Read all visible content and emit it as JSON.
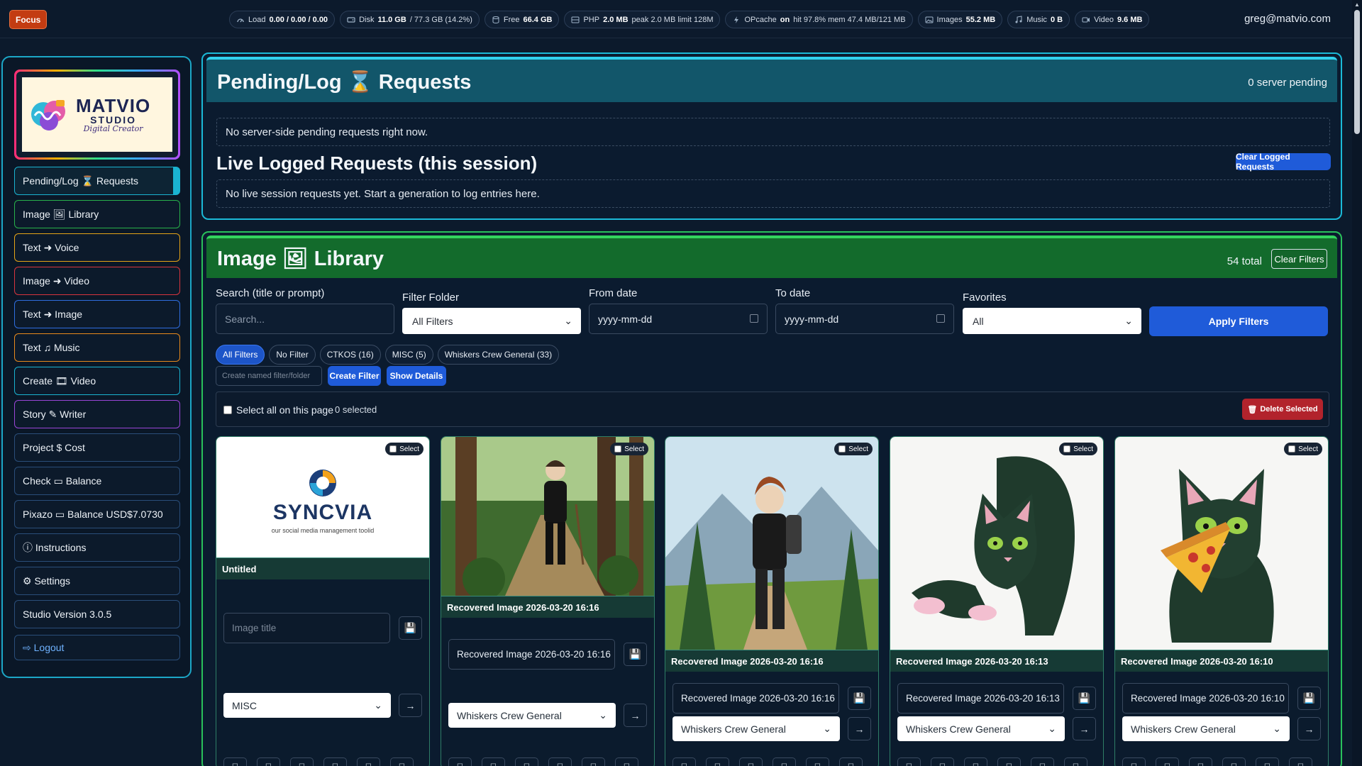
{
  "topbar": {
    "focus_label": "Focus",
    "stats": [
      {
        "icon": "gauge-icon",
        "label": "Load",
        "value": "0.00 / 0.00 / 0.00",
        "suffix": ""
      },
      {
        "icon": "disk-icon",
        "label": "Disk",
        "value": "11.0 GB",
        "suffix": "/ 77.3 GB (14.2%)"
      },
      {
        "icon": "storage-icon",
        "label": "Free",
        "value": "66.4 GB",
        "suffix": ""
      },
      {
        "icon": "server-icon",
        "label": "PHP",
        "value": "2.0 MB",
        "suffix": "peak 2.0 MB limit 128M"
      },
      {
        "icon": "bolt-icon",
        "label": "OPcache",
        "value": "on",
        "suffix": "hit 97.8% mem 47.4 MB/121 MB"
      },
      {
        "icon": "image-icon",
        "label": "Images",
        "value": "55.2 MB",
        "suffix": ""
      },
      {
        "icon": "music-icon",
        "label": "Music",
        "value": "0 B",
        "suffix": ""
      },
      {
        "icon": "video-icon",
        "label": "Video",
        "value": "9.6 MB",
        "suffix": ""
      }
    ],
    "user_email": "greg@matvio.com"
  },
  "logo": {
    "line1": "MATVIO",
    "line2": "STUDIO",
    "line3": "Digital Creator"
  },
  "sidebar": {
    "items": [
      {
        "label": "Pending/Log ⌛ Requests",
        "color": "#1ab3d1",
        "active": true
      },
      {
        "label": "Image 🖼 Library",
        "color": "#28b24b"
      },
      {
        "label": "Text ➜ Voice",
        "color": "#e6a417"
      },
      {
        "label": "Image ➜ Video",
        "color": "#d8353e"
      },
      {
        "label": "Text ➜ Image",
        "color": "#2f6ee0"
      },
      {
        "label": "Text ♫ Music",
        "color": "#e98a1c"
      },
      {
        "label": "Create 🎞 Video",
        "color": "#1ab3d1"
      },
      {
        "label": "Story ✎ Writer",
        "color": "#9a46d8"
      },
      {
        "label": "Project $ Cost",
        "color": "#2a4e7a"
      },
      {
        "label": "Check ▭ Balance",
        "color": "#2a4e7a"
      },
      {
        "label": "Pixazo ▭ Balance USD$7.0730",
        "color": "#2a4e7a"
      },
      {
        "label": "ⓘ Instructions",
        "color": "#2a4e7a"
      },
      {
        "label": "⚙ Settings",
        "color": "#2a4e7a"
      },
      {
        "label": "Studio Version 3.0.5",
        "color": "#2a4e7a"
      },
      {
        "label": "⇨ Logout",
        "color": "#2a4e7a",
        "link": true
      }
    ]
  },
  "pending": {
    "title": "Pending/Log ⌛ Requests",
    "count": "0 server pending",
    "empty_msg": "No server-side pending requests right now.",
    "live_title": "Live Logged Requests (this session)",
    "clear_btn": "Clear Logged Requests",
    "live_empty_msg": "No live session requests yet. Start a generation to log entries here."
  },
  "library": {
    "title": "Image 🖼 Library",
    "total": "54 total",
    "clear_filters": "Clear Filters",
    "filters": {
      "search_label": "Search (title or prompt)",
      "search_placeholder": "Search...",
      "folder_label": "Filter Folder",
      "folder_value": "All Filters",
      "from_label": "From date",
      "from_placeholder": "yyyy-mm-dd",
      "to_label": "To date",
      "to_placeholder": "yyyy-mm-dd",
      "fav_label": "Favorites",
      "fav_value": "All",
      "apply": "Apply Filters"
    },
    "chips": [
      {
        "label": "All Filters",
        "active": true
      },
      {
        "label": "No Filter"
      },
      {
        "label": "CTKOS (16)"
      },
      {
        "label": "MISC (5)"
      },
      {
        "label": "Whiskers Crew General (33)"
      }
    ],
    "named_placeholder": "Create named filter/folder",
    "create_filter": "Create Filter",
    "show_details": "Show Details",
    "select_all": "Select all on this page",
    "selected_count": "0 selected",
    "delete_selected": "Delete Selected",
    "select_badge": "Select",
    "cards": [
      {
        "title": "Untitled",
        "input_value": "",
        "input_placeholder": "Image title",
        "folder": "MISC",
        "image": "syncvia-logo"
      },
      {
        "title": "Recovered Image 2026-03-20 16:16",
        "input_value": "Recovered Image 2026-03-20 16:16",
        "folder": "Whiskers Crew General",
        "image": "forest-walker"
      },
      {
        "title": "Recovered Image 2026-03-20 16:16",
        "input_value": "Recovered Image 2026-03-20 16:16",
        "folder": "Whiskers Crew General",
        "image": "mountain-hiker"
      },
      {
        "title": "Recovered Image 2026-03-20 16:13",
        "input_value": "Recovered Image 2026-03-20 16:13",
        "folder": "Whiskers Crew General",
        "image": "stretching-cat"
      },
      {
        "title": "Recovered Image 2026-03-20 16:10",
        "input_value": "Recovered Image 2026-03-20 16:10",
        "folder": "Whiskers Crew General",
        "image": "pizza-cat"
      }
    ],
    "syncvia": {
      "name": "SYNCVIA",
      "tagline": "our social media management toolid"
    }
  }
}
